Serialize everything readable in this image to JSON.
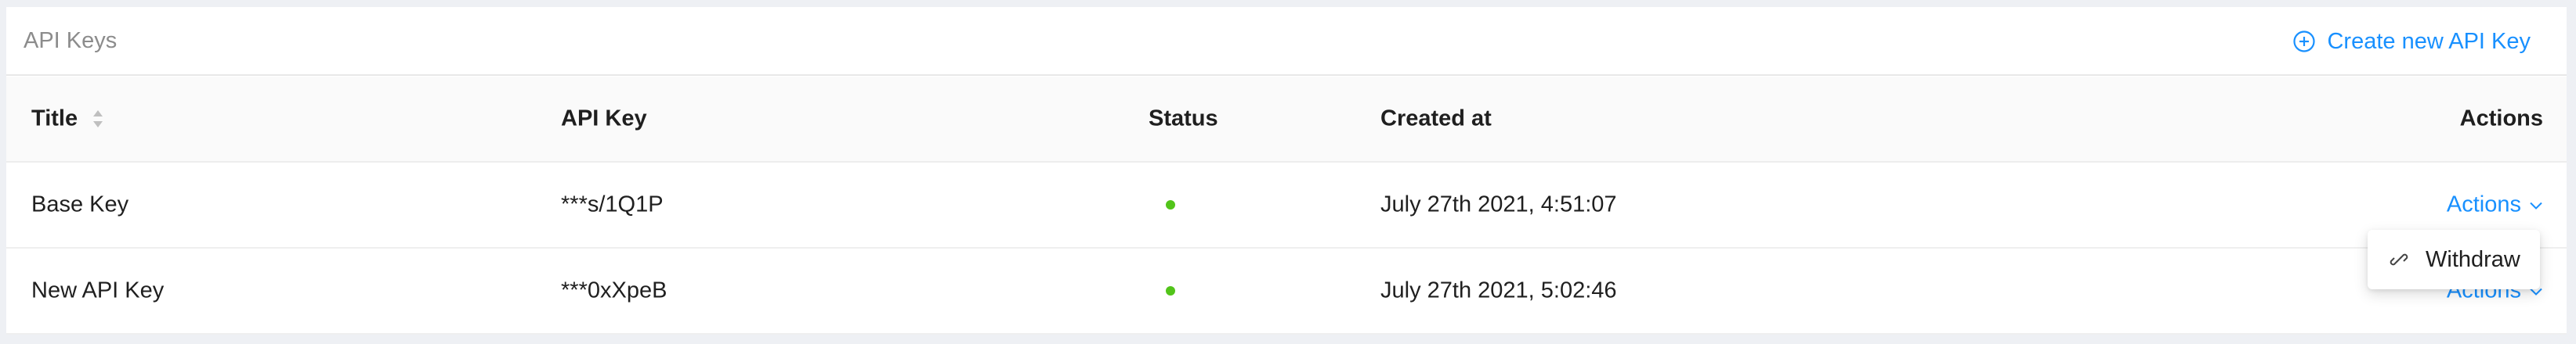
{
  "header": {
    "title": "API Keys",
    "create_label": "Create new API Key",
    "create_icon": "plus-circle-icon"
  },
  "table": {
    "columns": [
      "Title",
      "API Key",
      "Status",
      "Created at",
      "Actions"
    ],
    "rows": [
      {
        "title": "Base Key",
        "api_key": "***s/1Q1P",
        "status": "active",
        "created_at": "July 27th 2021, 4:51:07",
        "actions_label": "Actions"
      },
      {
        "title": "New API Key",
        "api_key": "***0xXpeB",
        "status": "active",
        "created_at": "July 27th 2021, 5:02:46",
        "actions_label": "Actions"
      }
    ]
  },
  "dropdown": {
    "items": [
      {
        "label": "Withdraw",
        "icon": "unlink-icon"
      }
    ]
  },
  "colors": {
    "accent": "#1890ff",
    "status_active": "#52c41a",
    "page_bg": "#eef0f4"
  }
}
